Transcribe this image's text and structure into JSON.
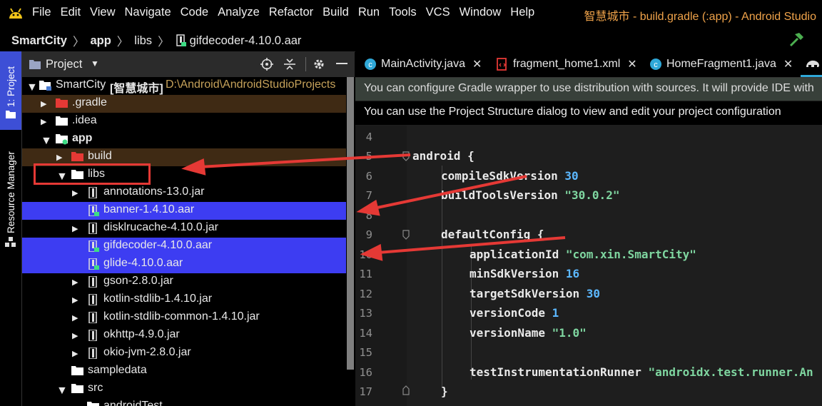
{
  "menubar": {
    "items": [
      {
        "label": "File"
      },
      {
        "label": "Edit"
      },
      {
        "label": "View"
      },
      {
        "label": "Navigate"
      },
      {
        "label": "Code"
      },
      {
        "label": "Analyze"
      },
      {
        "label": "Refactor"
      },
      {
        "label": "Build"
      },
      {
        "label": "Run"
      },
      {
        "label": "Tools"
      },
      {
        "label": "VCS"
      },
      {
        "label": "Window"
      },
      {
        "label": "Help"
      }
    ],
    "window_title": "智慧城市 - build.gradle (:app) - Android Studio"
  },
  "breadcrumb": {
    "items": [
      "SmartCity",
      "app",
      "libs",
      "gifdecoder-4.10.0.aar"
    ]
  },
  "toolstrip": {
    "project_label": "1: Project",
    "resource_manager_label": "Resource Manager"
  },
  "project_panel": {
    "title": "Project",
    "root": {
      "name": "SmartCity",
      "alias": "[智慧城市]",
      "path": "D:\\Android\\AndroidStudioProjects"
    },
    "tree": [
      {
        "label": ".gradle"
      },
      {
        "label": ".idea"
      },
      {
        "label": "app"
      },
      {
        "label": "build"
      },
      {
        "label": "libs"
      },
      {
        "label": "annotations-13.0.jar"
      },
      {
        "label": "banner-1.4.10.aar"
      },
      {
        "label": "disklrucache-4.10.0.jar"
      },
      {
        "label": "gifdecoder-4.10.0.aar"
      },
      {
        "label": "glide-4.10.0.aar"
      },
      {
        "label": "gson-2.8.0.jar"
      },
      {
        "label": "kotlin-stdlib-1.4.10.jar"
      },
      {
        "label": "kotlin-stdlib-common-1.4.10.jar"
      },
      {
        "label": "okhttp-4.9.0.jar"
      },
      {
        "label": "okio-jvm-2.8.0.jar"
      },
      {
        "label": "sampledata"
      },
      {
        "label": "src"
      },
      {
        "label": "androidTest"
      }
    ]
  },
  "editor": {
    "tabs": [
      {
        "label": "MainActivity.java"
      },
      {
        "label": "fragment_home1.xml"
      },
      {
        "label": "HomeFragment1.java"
      }
    ],
    "notice_gradle": "You can configure Gradle wrapper to use distribution with sources. It will provide IDE with",
    "notice_structure": "You can use the Project Structure dialog to view and edit your project configuration",
    "line_numbers": [
      "4",
      "5",
      "6",
      "7",
      "8",
      "9",
      "10",
      "11",
      "12",
      "13",
      "14",
      "15",
      "16",
      "17"
    ],
    "code": {
      "l5": "android {",
      "l6_key": "compileSdkVersion ",
      "l6_val": "30",
      "l7_key": "buildToolsVersion ",
      "l7_val": "\"30.0.2\"",
      "l9": "defaultConfig {",
      "l10_key": "applicationId ",
      "l10_val": "\"com.xin.SmartCity\"",
      "l11_key": "minSdkVersion ",
      "l11_val": "16",
      "l12_key": "targetSdkVersion ",
      "l12_val": "30",
      "l13_key": "versionCode ",
      "l13_val": "1",
      "l14_key": "versionName ",
      "l14_val": "\"1.0\"",
      "l16_key": "testInstrumentationRunner ",
      "l16_val": "\"androidx.test.runner.An",
      "l17": "}"
    }
  },
  "colors": {
    "selection": "#3d3df2",
    "annotation_red": "#e53935",
    "title_orange": "#f0a34a",
    "number_blue": "#5cb8ff",
    "string_green": "#7fd6a0"
  }
}
